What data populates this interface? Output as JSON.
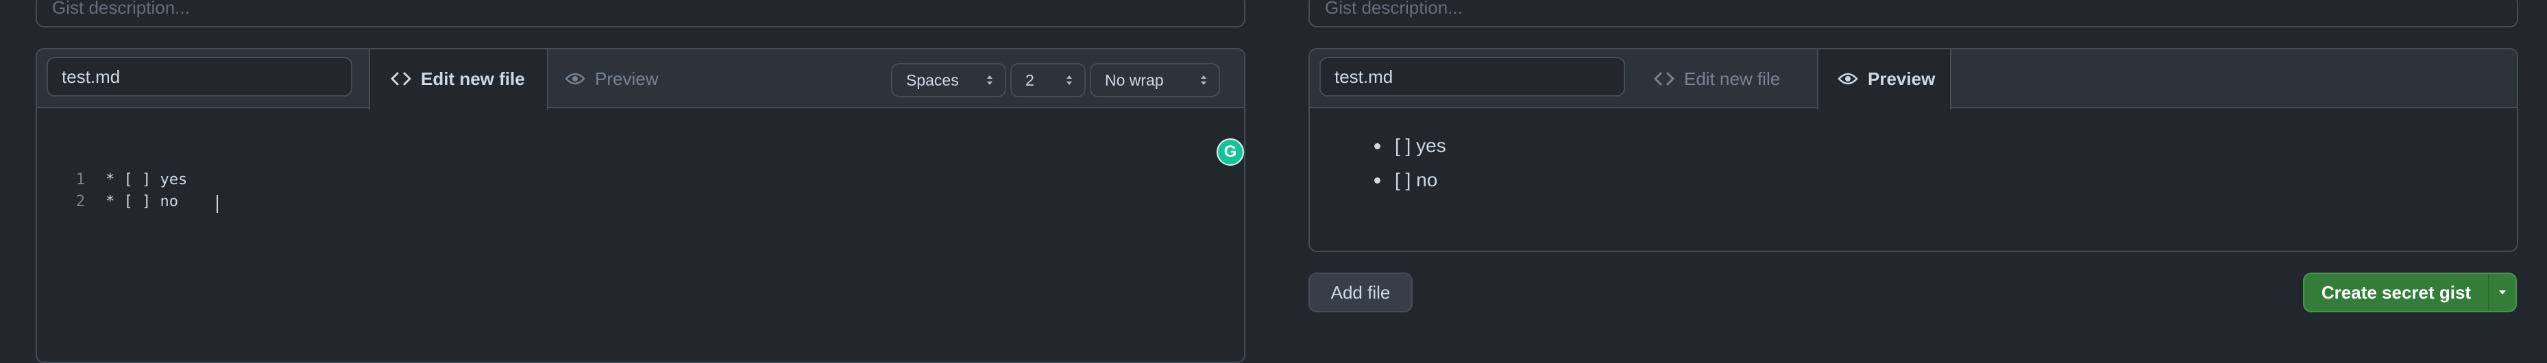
{
  "left": {
    "description_placeholder": "Gist description...",
    "filename": "test.md",
    "tabs": [
      {
        "label": "Edit new file",
        "icon": "code-icon",
        "active": true
      },
      {
        "label": "Preview",
        "icon": "eye-icon",
        "active": false
      }
    ],
    "indent_mode": "Spaces",
    "indent_size": "2",
    "wrap_mode": "No wrap",
    "lines": [
      {
        "num": "1",
        "text": "* [ ] yes"
      },
      {
        "num": "2",
        "text": "* [ ] no"
      }
    ],
    "grammarly_badge": "G"
  },
  "right": {
    "description_placeholder": "Gist description...",
    "filename": "test.md",
    "tabs": [
      {
        "label": "Edit new file",
        "icon": "code-icon",
        "active": false
      },
      {
        "label": "Preview",
        "icon": "eye-icon",
        "active": true
      }
    ],
    "preview_items": [
      "[ ] yes",
      "[ ] no"
    ],
    "add_file_label": "Add file",
    "create_label": "Create secret gist"
  },
  "colors": {
    "background": "#22272e",
    "header": "#2d333b",
    "border": "#444c56",
    "primary_button": "#347d39",
    "grammarly": "#15c39a"
  }
}
